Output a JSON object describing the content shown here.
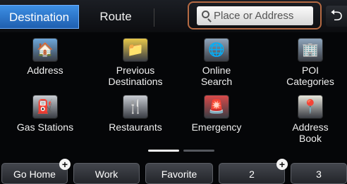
{
  "tabs": {
    "destination": "Destination",
    "route": "Route"
  },
  "search": {
    "placeholder": "Place or Address"
  },
  "back": {
    "glyph": "⮌"
  },
  "menu": [
    {
      "id": "address",
      "label_lines": [
        "Address"
      ],
      "icon": "house-icon",
      "color": "#6ea8dc",
      "glyph": "🏠"
    },
    {
      "id": "previous-destinations",
      "label_lines": [
        "Previous",
        "Destinations"
      ],
      "icon": "folder-clock-icon",
      "color": "#e7c84a",
      "glyph": "📁"
    },
    {
      "id": "online-search",
      "label_lines": [
        "Online",
        "Search"
      ],
      "icon": "globe-icon",
      "color": "#8fa6bd",
      "glyph": "🌐"
    },
    {
      "id": "poi-categories",
      "label_lines": [
        "POI",
        "Categories"
      ],
      "icon": "building-icon",
      "color": "#8fa6bd",
      "glyph": "🏢"
    },
    {
      "id": "gas-stations",
      "label_lines": [
        "Gas Stations"
      ],
      "icon": "gas-pump-icon",
      "color": "#c9cdd3",
      "glyph": "⛽"
    },
    {
      "id": "restaurants",
      "label_lines": [
        "Restaurants"
      ],
      "icon": "fork-knife-icon",
      "color": "#c9cdd3",
      "glyph": "🍴"
    },
    {
      "id": "emergency",
      "label_lines": [
        "Emergency"
      ],
      "icon": "siren-icon",
      "color": "#d94a4a",
      "glyph": "🚨"
    },
    {
      "id": "address-book",
      "label_lines": [
        "Address",
        "Book"
      ],
      "icon": "address-book-icon",
      "color": "#e8e6dc",
      "glyph": "📍"
    }
  ],
  "pager": {
    "active_page": 1,
    "page_count": 2
  },
  "quick_buttons": [
    {
      "label": "Go Home",
      "has_add": true
    },
    {
      "label": "Work",
      "has_add": false
    },
    {
      "label": "Favorite",
      "has_add": false
    },
    {
      "label": "2",
      "has_add": true
    },
    {
      "label": "3",
      "has_add": false
    }
  ],
  "colors": {
    "accent": "#2f78d0",
    "highlight_frame": "#b56a43"
  }
}
